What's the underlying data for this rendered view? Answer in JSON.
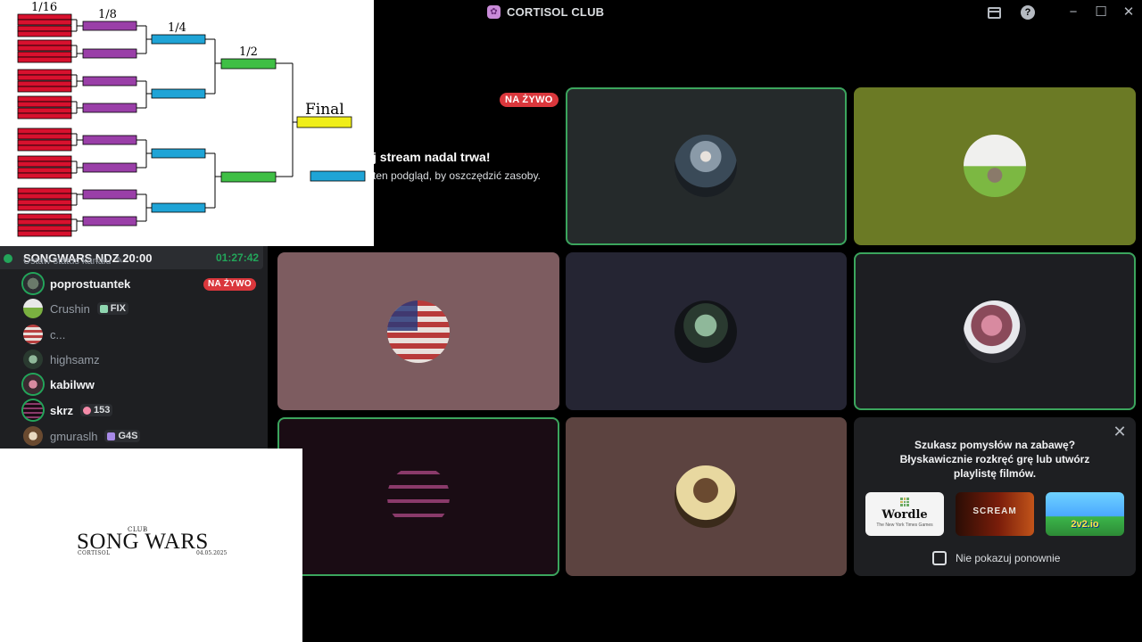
{
  "window": {
    "title": "CORTISOL CLUB"
  },
  "channel": {
    "name": "SONGWARS NDZ 20:00",
    "timer": "01:27:42",
    "status_text": "Ustaw status kanału"
  },
  "members": [
    {
      "name": "poprostuantek",
      "speaking": true,
      "live": "NA ŻYWO"
    },
    {
      "name": "Crushin",
      "tag": "FIX"
    },
    {
      "name": "c..."
    },
    {
      "name": "highsamz"
    },
    {
      "name": "kabilww",
      "speaking": true
    },
    {
      "name": "skrz",
      "speaking": true,
      "tag": "153"
    },
    {
      "name": "gmuraslh",
      "tag": "G4S"
    }
  ],
  "stream_notice": {
    "live_label": "NA ŻYWO",
    "title": "j stream nadal trwa!",
    "subtitle": "ten podgląd, by oszczędzić zasoby."
  },
  "activities": {
    "prompt": "Szukasz pomysłów na zabawę? Błyskawicznie rozkręć grę lub utwórz playlistę filmów.",
    "games": [
      {
        "name": "Wordle",
        "subtitle": "The New York Times Games"
      },
      {
        "name": "SCREAM"
      },
      {
        "name": "2v2.io"
      }
    ],
    "checkbox_label": "Nie pokazuj ponownie"
  },
  "bracket": {
    "rounds": [
      "1/16",
      "1/8",
      "1/4",
      "1/2",
      "Final"
    ],
    "colors": {
      "r16": "#d8112e",
      "r8": "#9a3fa8",
      "r4": "#1fa4d6",
      "semi": "#3fbf45",
      "final": "#f0ee1a"
    }
  },
  "logo": {
    "club": "CLUB",
    "title": "SONG WARS",
    "subtitle": "CORTISOL",
    "date": "04.05.2025"
  },
  "colors": {
    "accent_green": "#23a55a",
    "live_red": "#da373c"
  }
}
